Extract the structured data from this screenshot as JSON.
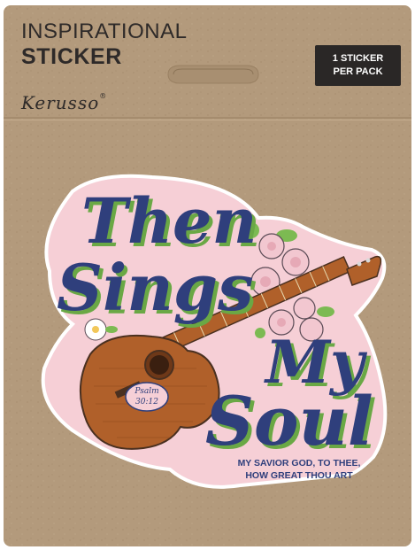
{
  "package": {
    "title_line1": "INSPIRATIONAL",
    "title_line2": "STICKER",
    "brand": "Kerusso",
    "brand_mark": "®",
    "badge_line1": "1 STICKER",
    "badge_line2": "PER PACK"
  },
  "sticker": {
    "word1": "Then",
    "word2": "Sings",
    "word3": "My",
    "word4": "Soul",
    "verse_ref_line1": "Psalm",
    "verse_ref_line2": "30:12",
    "subtitle_line1": "MY SAVIOR GOD, TO THEE,",
    "subtitle_line2": "HOW GREAT THOU ART"
  },
  "colors": {
    "kraft": "#b39a7c",
    "ink": "#2e2a29",
    "navy": "#2f3f7c",
    "green": "#6aa845",
    "pink": "#f6cfd6",
    "wood": "#b0602a"
  }
}
